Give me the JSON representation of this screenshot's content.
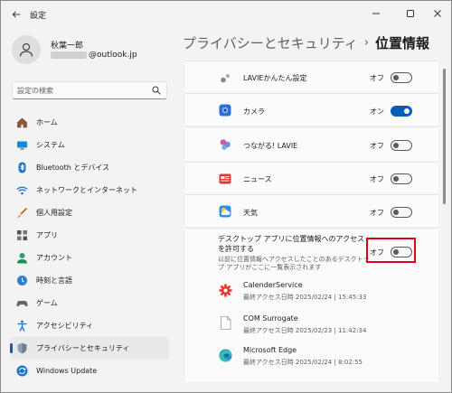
{
  "window": {
    "title": "設定"
  },
  "profile": {
    "name": "秋葉一郎",
    "email_suffix": "@outlook.jp"
  },
  "search": {
    "placeholder": "設定の検索"
  },
  "nav": {
    "items": [
      {
        "label": "ホーム",
        "icon": "home-icon"
      },
      {
        "label": "システム",
        "icon": "system-icon"
      },
      {
        "label": "Bluetooth とデバイス",
        "icon": "bluetooth-icon"
      },
      {
        "label": "ネットワークとインターネット",
        "icon": "network-icon"
      },
      {
        "label": "個人用設定",
        "icon": "brush-icon"
      },
      {
        "label": "アプリ",
        "icon": "apps-icon"
      },
      {
        "label": "アカウント",
        "icon": "account-icon"
      },
      {
        "label": "時刻と言語",
        "icon": "time-language-icon"
      },
      {
        "label": "ゲーム",
        "icon": "gaming-icon"
      },
      {
        "label": "アクセシビリティ",
        "icon": "accessibility-icon"
      },
      {
        "label": "プライバシーとセキュリティ",
        "icon": "shield-icon",
        "active": true
      },
      {
        "label": "Windows Update",
        "icon": "update-icon"
      }
    ]
  },
  "header": {
    "parent": "プライバシーとセキュリティ",
    "separator": "›",
    "current": "位置情報"
  },
  "apps": [
    {
      "name": "LAVIEかんたん設定",
      "state": "オフ",
      "on": false,
      "icon": "lavie-settings-icon"
    },
    {
      "name": "カメラ",
      "state": "オン",
      "on": true,
      "icon": "camera-icon"
    },
    {
      "name": "つながる! LAVIE",
      "state": "オフ",
      "on": false,
      "icon": "tsunagaru-lavie-icon"
    },
    {
      "name": "ニュース",
      "state": "オフ",
      "on": false,
      "icon": "news-icon"
    },
    {
      "name": "天気",
      "state": "オフ",
      "on": false,
      "icon": "weather-icon"
    }
  ],
  "desktop": {
    "title": "デスクトップ アプリに位置情報へのアクセスを許可する",
    "description": "以前に位置情報へアクセスしたことのあるデスクトップ アプリがここに一覧表示されます",
    "state": "オフ",
    "on": false,
    "apps": [
      {
        "name": "CalenderService",
        "access": "最終アクセス日時 2025/02/24 | 15:45:33",
        "icon": "gear-app-icon"
      },
      {
        "name": "COM Surrogate",
        "access": "最終アクセス日時 2025/02/23 | 11:42:34",
        "icon": "document-icon"
      },
      {
        "name": "Microsoft Edge",
        "access": "最終アクセス日時 2025/02/24 | 8:02:55",
        "icon": "edge-icon"
      }
    ]
  },
  "colors": {
    "accent": "#005fb8",
    "highlight": "#e0001a"
  }
}
